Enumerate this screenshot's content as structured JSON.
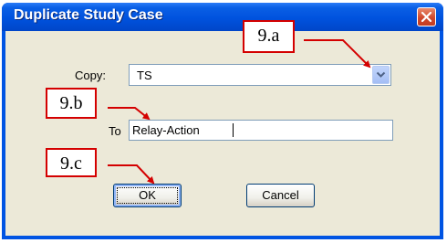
{
  "dialog": {
    "title": "Duplicate Study Case",
    "copy_label": "Copy:",
    "copy_value": "TS",
    "to_label": "To",
    "to_value": "Relay-Action",
    "ok_label": "OK",
    "cancel_label": "Cancel"
  },
  "annotations": [
    {
      "label": "9.a"
    },
    {
      "label": "9.b"
    },
    {
      "label": "9.c"
    }
  ],
  "colors": {
    "annotation": "#d40000",
    "titlebar": "#0054e3",
    "window_face": "#ece9d8"
  }
}
